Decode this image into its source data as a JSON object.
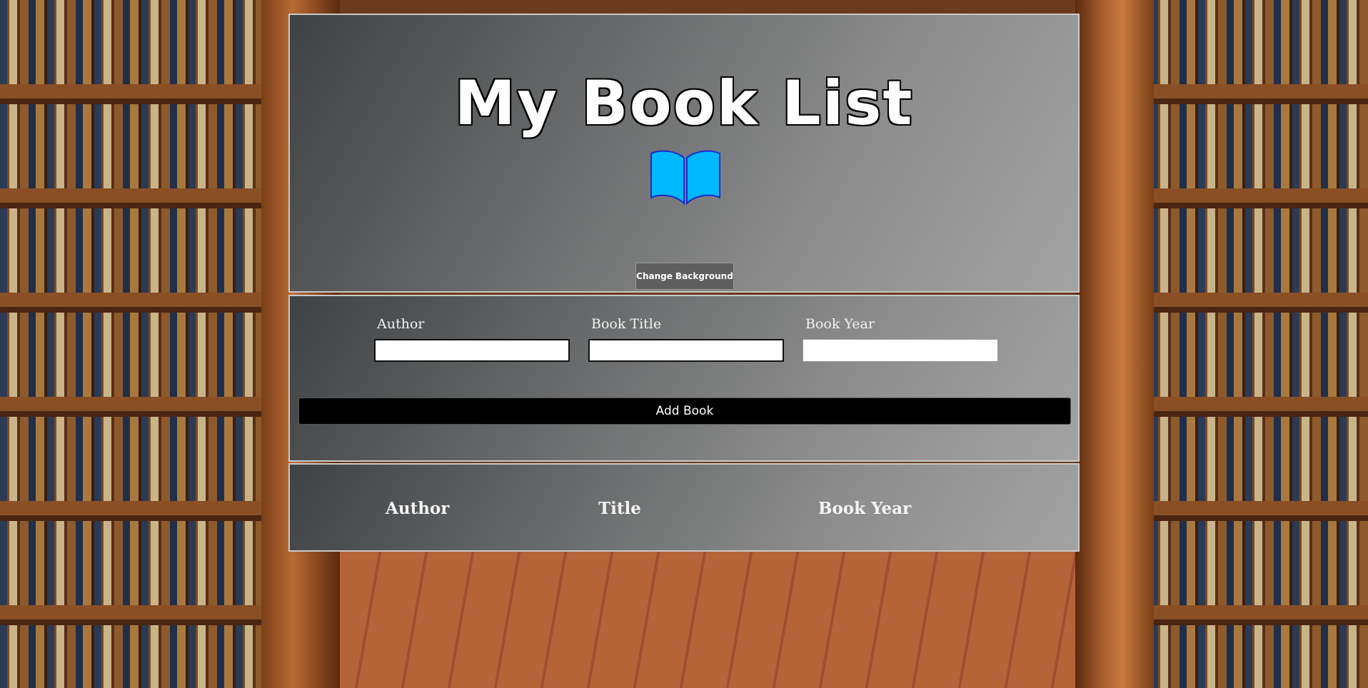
{
  "header": {
    "title": "My Book List",
    "change_background_label": "Change Background"
  },
  "form": {
    "author_label": "Author",
    "title_label": "Book Title",
    "year_label": "Book Year",
    "author_value": "",
    "title_value": "",
    "year_value": "",
    "add_button_label": "Add Book"
  },
  "list": {
    "columns": [
      "Author",
      "Title",
      "Book Year"
    ]
  },
  "icons": {
    "book": "open-book-icon",
    "book_color": "#00b8ff"
  },
  "colors": {
    "button_dark": "#000000",
    "panel_border": "#c9c9c9"
  }
}
